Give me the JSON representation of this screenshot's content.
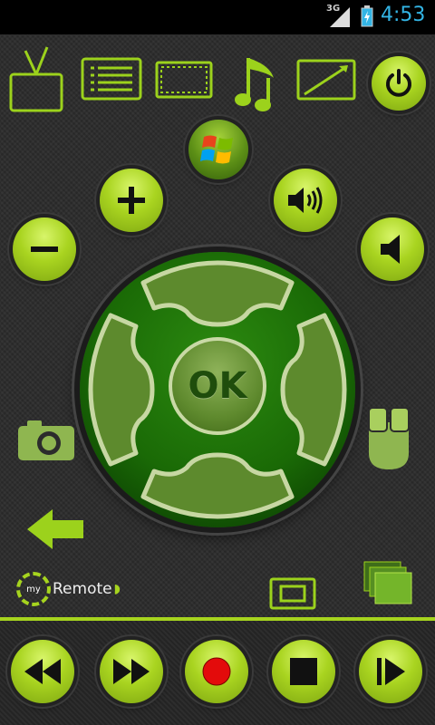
{
  "status_bar": {
    "network": "3G",
    "time": "4:53"
  },
  "remote": {
    "ok_label": "OK",
    "logo": {
      "prefix": "my",
      "word": "Remote"
    }
  },
  "colors": {
    "accent": "#a6d41e",
    "dpad": "#1a6a06",
    "time": "#33b5e5"
  },
  "icons": [
    "tv-icon",
    "guide-list-icon",
    "widescreen-icon",
    "music-icon",
    "aspect-icon",
    "power-icon",
    "windows-logo-icon",
    "volume-up-plus-icon",
    "volume-down-minus-icon",
    "speaker-loud-icon",
    "speaker-mute-icon",
    "camera-icon",
    "mouse-icon",
    "back-arrow-icon",
    "screen-icon",
    "gallery-icon",
    "rewind-icon",
    "fast-forward-icon",
    "record-icon",
    "stop-icon",
    "play-icon"
  ]
}
